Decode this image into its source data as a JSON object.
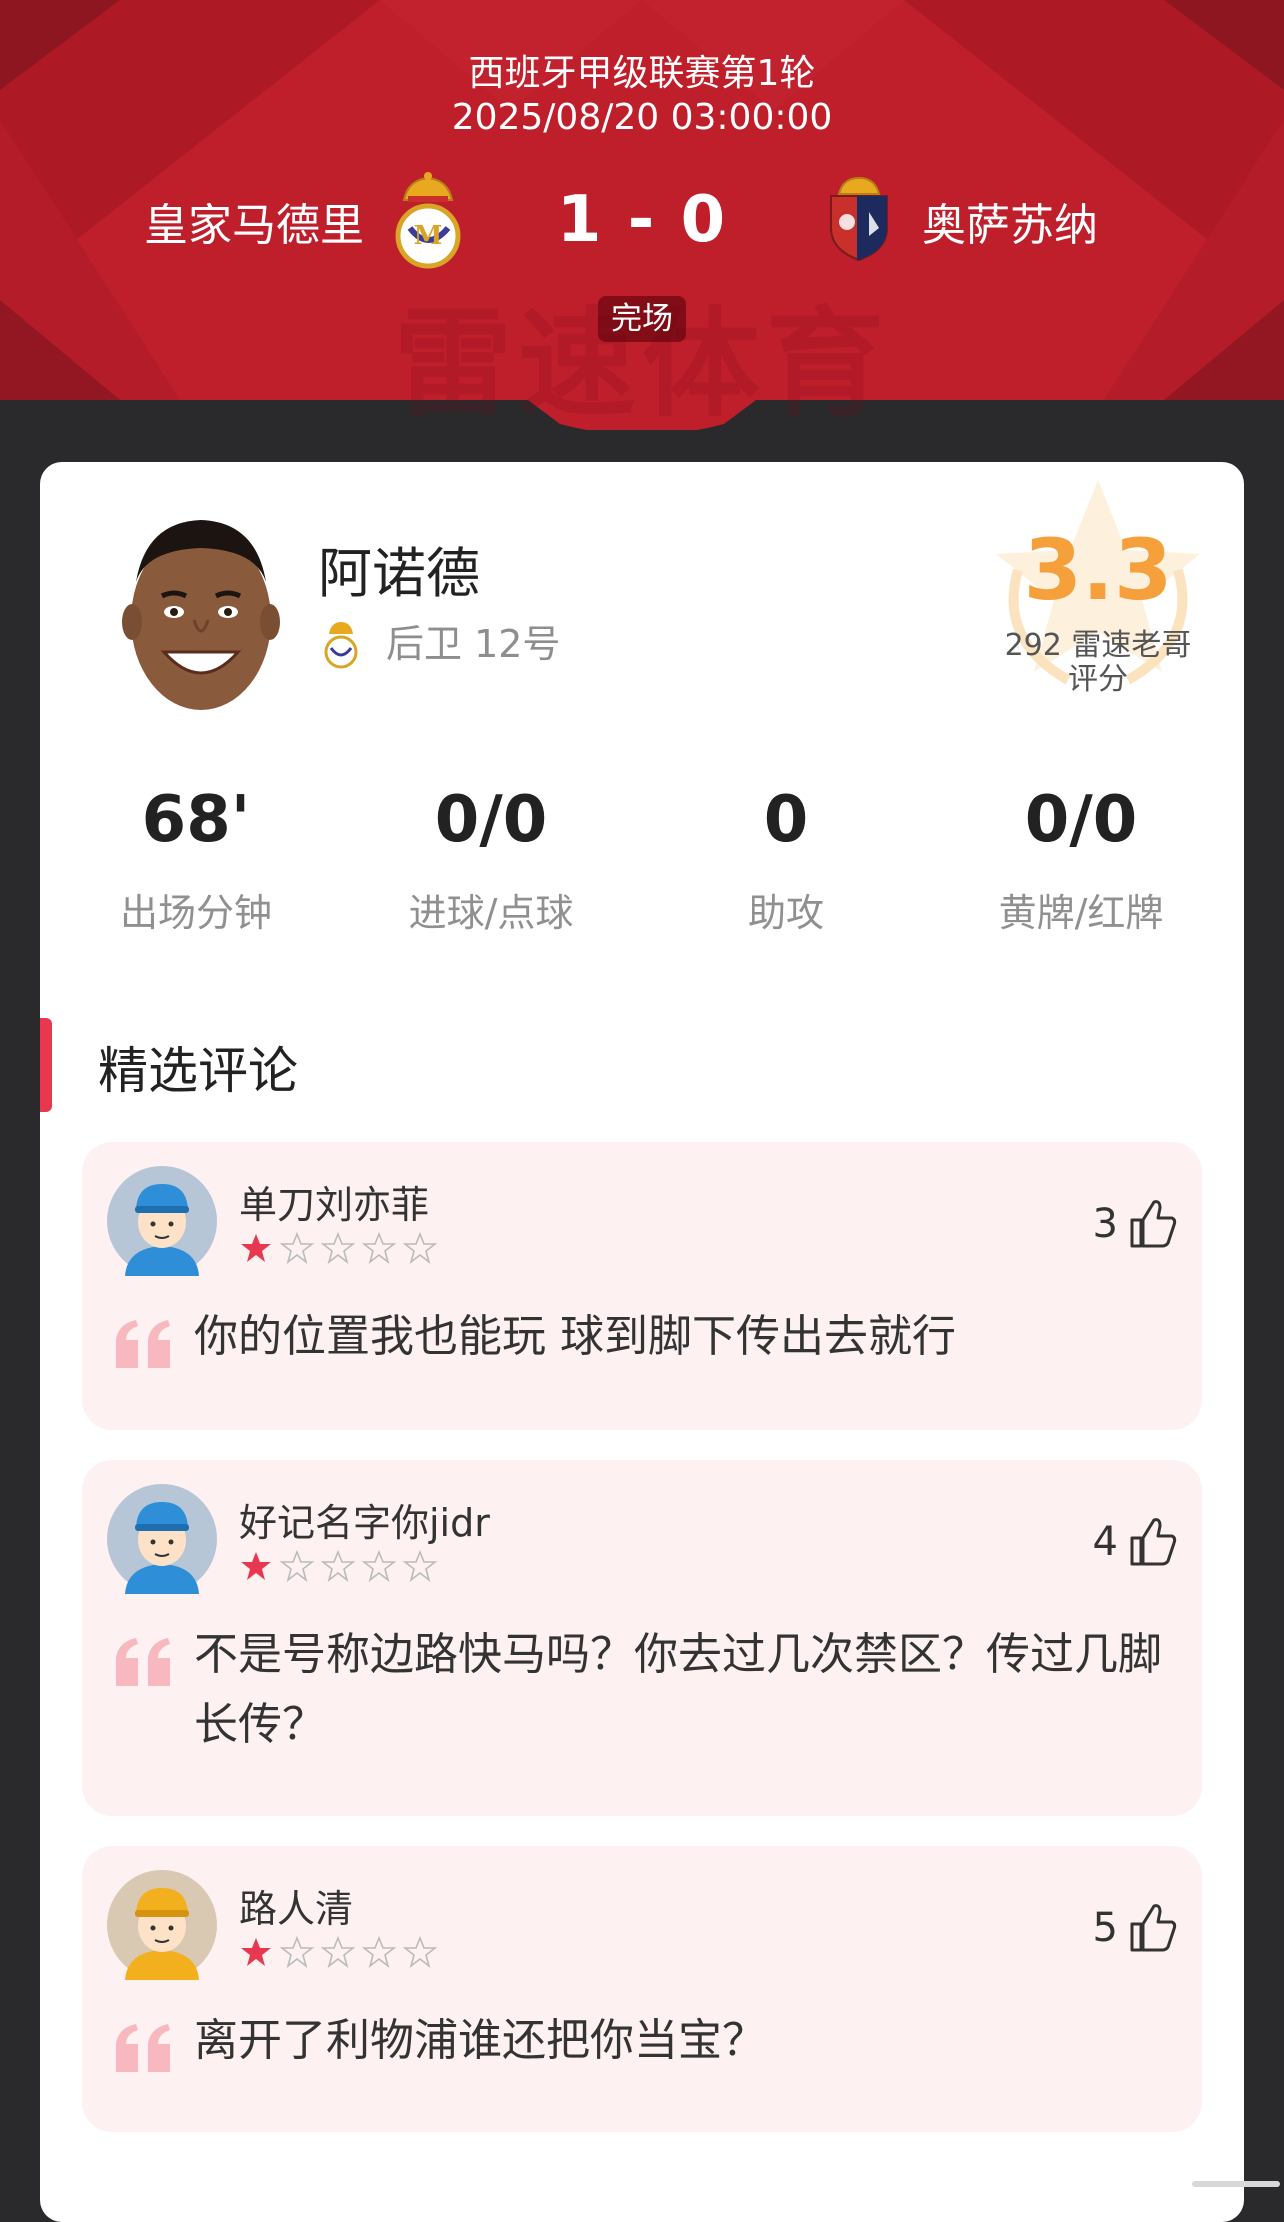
{
  "header": {
    "league_round": "西班牙甲级联赛第1轮",
    "datetime": "2025/08/20 03:00:00",
    "home_team": "皇家马德里",
    "away_team": "奥萨苏纳",
    "score": "1 - 0",
    "status": "完场",
    "watermark": "雷速体育",
    "colors": {
      "primary": "#c01f2c",
      "dark": "#8e1620"
    }
  },
  "player": {
    "name": "阿诺德",
    "position_number": "后卫 12号",
    "rating": "3.3",
    "rating_count_text": "292 雷速老哥",
    "rating_label": "评分",
    "rating_color": "#f5a03a"
  },
  "stats": [
    {
      "value": "68'",
      "label": "出场分钟"
    },
    {
      "value": "0/0",
      "label": "进球/点球"
    },
    {
      "value": "0",
      "label": "助攻"
    },
    {
      "value": "0/0",
      "label": "黄牌/红牌"
    }
  ],
  "comments_section": {
    "title": "精选评论",
    "accent_color": "#e8384f",
    "items": [
      {
        "username": "单刀刘亦菲",
        "rating": 1,
        "max_rating": 5,
        "likes": "3",
        "text": "你的位置我也能玩 球到脚下传出去就行",
        "avatar": "blue-cap-avatar"
      },
      {
        "username": "好记名字你jidr",
        "rating": 1,
        "max_rating": 5,
        "likes": "4",
        "text": "不是号称边路快马吗？你去过几次禁区？传过几脚长传？",
        "avatar": "blue-cap-avatar"
      },
      {
        "username": "路人清",
        "rating": 1,
        "max_rating": 5,
        "likes": "5",
        "text": "离开了利物浦谁还把你当宝？",
        "avatar": "yellow-cap-avatar"
      }
    ]
  }
}
